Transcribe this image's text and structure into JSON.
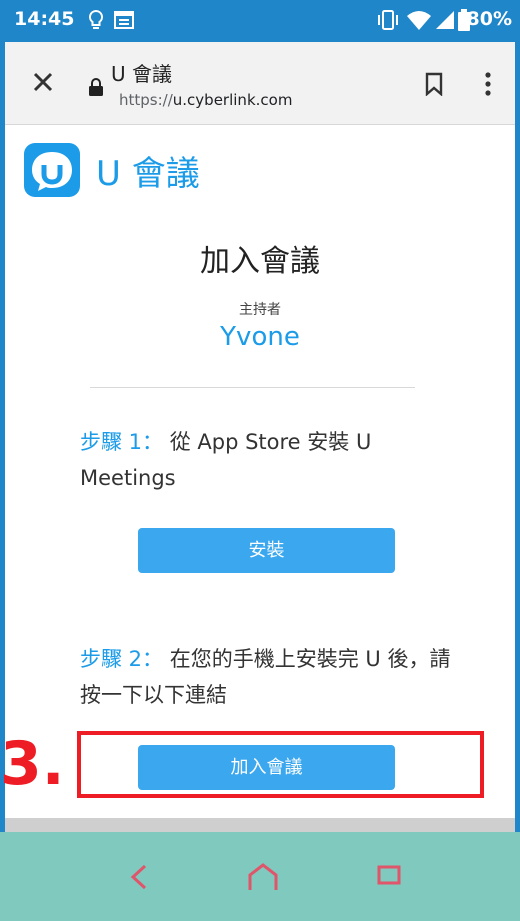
{
  "status_bar": {
    "time": "14:45",
    "battery": "80%"
  },
  "browser": {
    "page_title": "U 會議",
    "url_scheme": "https://",
    "url_host": "u.cyberlink.com"
  },
  "brand": {
    "name": "U 會議"
  },
  "main": {
    "heading": "加入會議",
    "host_label": "主持者",
    "host_name": "Yvone",
    "step1": {
      "label": "步驟 1：",
      "text": " 從 App Store 安裝 U Meetings",
      "button": "安裝"
    },
    "step2": {
      "label": "步驟 2：",
      "text": " 在您的手機上安裝完 U 後，請按一下以下連結",
      "button": "加入會議"
    }
  },
  "annotation": {
    "number": "3."
  },
  "colors": {
    "accent": "#1b9be8",
    "status_bar": "#1f86c9",
    "highlight": "#ee1c24",
    "nav_bar": "#7fc9be"
  },
  "icons": [
    "close-icon",
    "lock-icon",
    "bookmark-icon",
    "more-icon",
    "back-icon",
    "home-icon",
    "recents-icon",
    "wifi-icon",
    "signal-icon",
    "battery-icon",
    "vibrate-icon"
  ]
}
